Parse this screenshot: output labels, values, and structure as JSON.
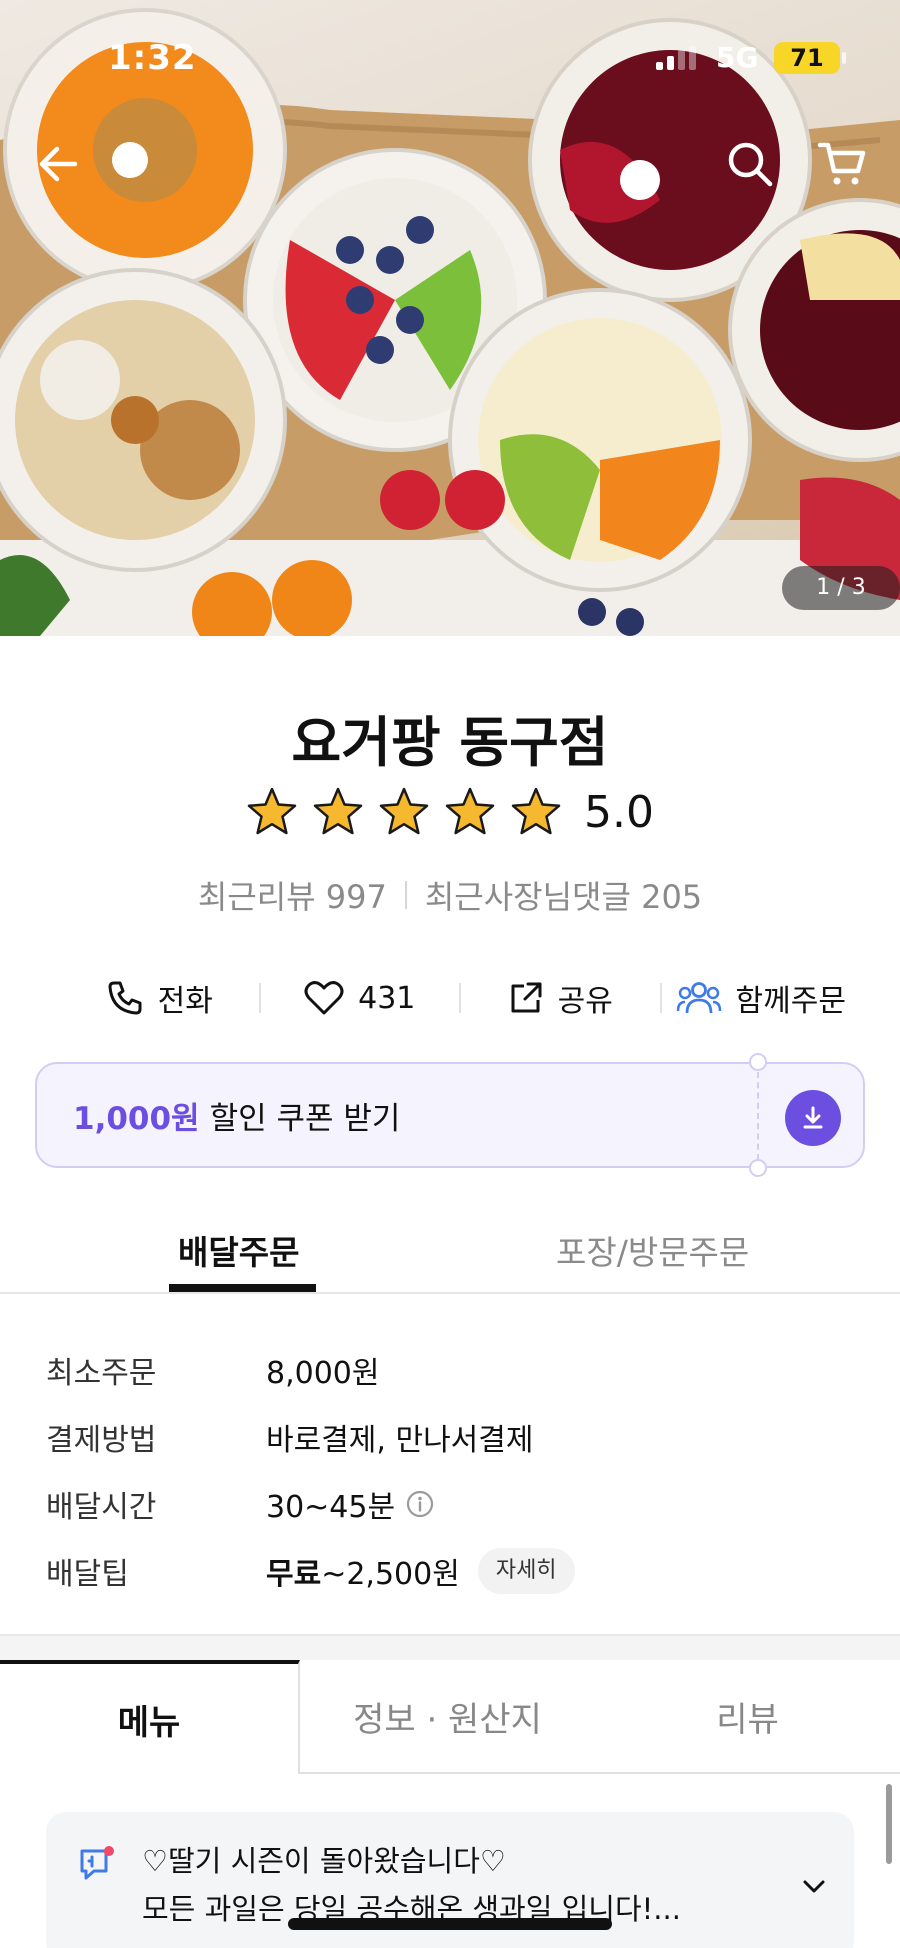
{
  "status_bar": {
    "time": "1:32",
    "network": "5G",
    "battery": "71"
  },
  "hero": {
    "pager": "1 / 3",
    "icons": {
      "back": "arrow-left-icon",
      "search": "search-icon",
      "cart": "cart-icon"
    }
  },
  "store": {
    "name": "요거팡 동구점",
    "rating": "5.0",
    "stars": 5,
    "recent_reviews": "최근리뷰 997",
    "owner_replies": "최근사장님댓글 205"
  },
  "actions": {
    "call": "전화",
    "like_count": "431",
    "share": "공유",
    "group_order": "함께주문"
  },
  "coupon": {
    "amount": "1,000원",
    "label": "할인 쿠폰 받기"
  },
  "order_tabs": {
    "delivery": "배달주문",
    "pickup": "포장/방문주문"
  },
  "delivery_info": {
    "min_order_label": "최소주문",
    "min_order_value": "8,000원",
    "payment_label": "결제방법",
    "payment_value": "바로결제, 만나서결제",
    "time_label": "배달시간",
    "time_value": "30~45분",
    "tip_label": "배달팁",
    "tip_free": "무료",
    "tip_range": "~2,500원",
    "detail_button": "자세히"
  },
  "menu_tabs": {
    "menu": "메뉴",
    "info": "정보 · 원산지",
    "review": "리뷰"
  },
  "notice": {
    "line1": "♡딸기 시즌이 돌아왔습니다♡",
    "line2": "모든 과일은 당일 공수해온 생과일 입니다!..."
  },
  "colors": {
    "accent": "#6c4fe0",
    "star": "#f5b82e",
    "group_icon": "#3f7be6"
  }
}
